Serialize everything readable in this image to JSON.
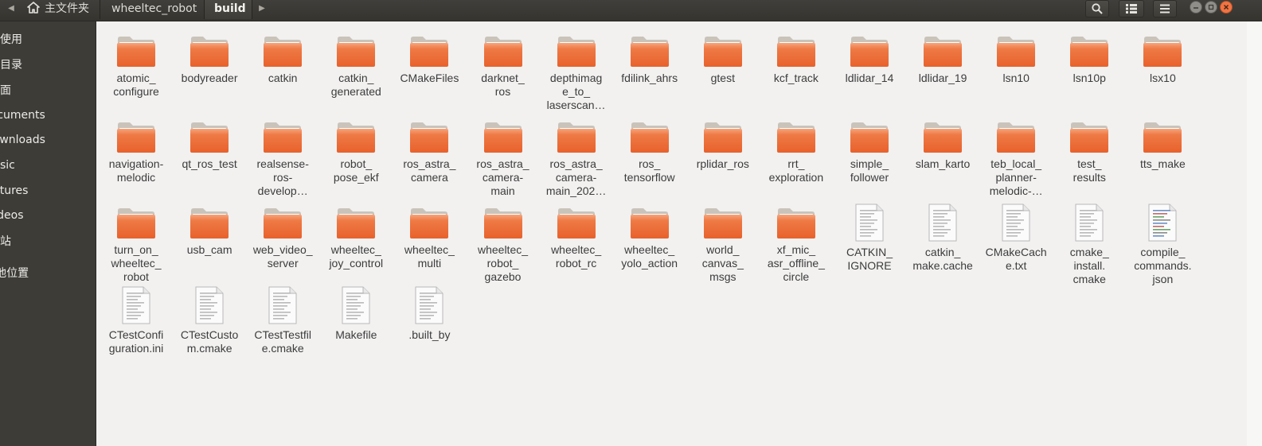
{
  "header": {
    "back_arrow": "◀",
    "forward_arrow": "▶",
    "breadcrumbs": [
      "主文件夹",
      "wheeltec_robot",
      "build"
    ],
    "buttons": {
      "search_icon": "search-icon",
      "view_icon": "grid-view-icon",
      "menu_icon": "hamburger-menu-icon"
    },
    "window_controls": [
      "minimize",
      "maximize",
      "close"
    ]
  },
  "sidebar": {
    "items": [
      {
        "label": "最近使用"
      },
      {
        "label": "主目录"
      },
      {
        "label": "桌面"
      },
      {
        "label": "Documents"
      },
      {
        "label": "Downloads"
      },
      {
        "label": "Music"
      },
      {
        "label": "Pictures"
      },
      {
        "label": "Videos"
      },
      {
        "label": "回收站"
      },
      {
        "label": "+ 其他位置"
      }
    ]
  },
  "files": [
    {
      "name": "atomic_\nconfigure",
      "type": "folder"
    },
    {
      "name": "bodyreader",
      "type": "folder"
    },
    {
      "name": "catkin",
      "type": "folder"
    },
    {
      "name": "catkin_\ngenerated",
      "type": "folder"
    },
    {
      "name": "CMakeFiles",
      "type": "folder"
    },
    {
      "name": "darknet_\nros",
      "type": "folder"
    },
    {
      "name": "depthimag\ne_to_\nlaserscan…",
      "type": "folder"
    },
    {
      "name": "fdilink_ahrs",
      "type": "folder"
    },
    {
      "name": "gtest",
      "type": "folder"
    },
    {
      "name": "kcf_track",
      "type": "folder"
    },
    {
      "name": "ldlidar_14",
      "type": "folder"
    },
    {
      "name": "ldlidar_19",
      "type": "folder"
    },
    {
      "name": "lsn10",
      "type": "folder"
    },
    {
      "name": "lsn10p",
      "type": "folder"
    },
    {
      "name": "lsx10",
      "type": "folder"
    },
    {
      "name": "navigation-\nmelodic",
      "type": "folder"
    },
    {
      "name": "qt_ros_test",
      "type": "folder"
    },
    {
      "name": "realsense-\nros-\ndevelop…",
      "type": "folder"
    },
    {
      "name": "robot_\npose_ekf",
      "type": "folder"
    },
    {
      "name": "ros_astra_\ncamera",
      "type": "folder"
    },
    {
      "name": "ros_astra_\ncamera-\nmain",
      "type": "folder"
    },
    {
      "name": "ros_astra_\ncamera-\nmain_202…",
      "type": "folder"
    },
    {
      "name": "ros_\ntensorflow",
      "type": "folder"
    },
    {
      "name": "rplidar_ros",
      "type": "folder"
    },
    {
      "name": "rrt_\nexploration",
      "type": "folder"
    },
    {
      "name": "simple_\nfollower",
      "type": "folder"
    },
    {
      "name": "slam_karto",
      "type": "folder"
    },
    {
      "name": "teb_local_\nplanner-\nmelodic-…",
      "type": "folder"
    },
    {
      "name": "test_\nresults",
      "type": "folder"
    },
    {
      "name": "tts_make",
      "type": "folder"
    },
    {
      "name": "turn_on_\nwheeltec_\nrobot",
      "type": "folder"
    },
    {
      "name": "usb_cam",
      "type": "folder"
    },
    {
      "name": "web_video_\nserver",
      "type": "folder"
    },
    {
      "name": "wheeltec_\njoy_control",
      "type": "folder"
    },
    {
      "name": "wheeltec_\nmulti",
      "type": "folder"
    },
    {
      "name": "wheeltec_\nrobot_\ngazebo",
      "type": "folder"
    },
    {
      "name": "wheeltec_\nrobot_rc",
      "type": "folder"
    },
    {
      "name": "wheeltec_\nyolo_action",
      "type": "folder"
    },
    {
      "name": "world_\ncanvas_\nmsgs",
      "type": "folder"
    },
    {
      "name": "xf_mic_\nasr_offline_\ncircle",
      "type": "folder"
    },
    {
      "name": "CATKIN_\nIGNORE",
      "type": "file"
    },
    {
      "name": "catkin_\nmake.cache",
      "type": "file"
    },
    {
      "name": "CMakeCach\ne.txt",
      "type": "file"
    },
    {
      "name": "cmake_\ninstall.\ncmake",
      "type": "file"
    },
    {
      "name": "compile_\ncommands.\njson",
      "type": "file-json"
    },
    {
      "name": "CTestConfi\nguration.ini",
      "type": "file"
    },
    {
      "name": "CTestCusto\nm.cmake",
      "type": "file"
    },
    {
      "name": "CTestTestfil\ne.cmake",
      "type": "file"
    },
    {
      "name": "Makefile",
      "type": "file"
    },
    {
      "name": ".built_by",
      "type": "file"
    }
  ],
  "colors": {
    "folder_orange": "#e8612c",
    "folder_light": "#f7a47c",
    "sidebar_bg": "#3d3c37",
    "header_bg": "#3a3935",
    "content_bg": "#f2f1f0"
  }
}
